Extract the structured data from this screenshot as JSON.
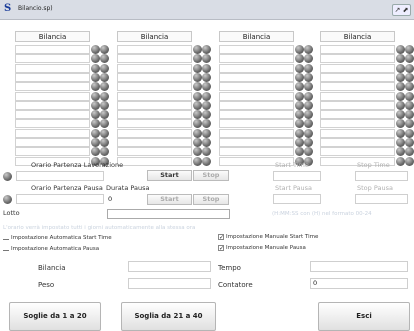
{
  "window": {
    "title": "Bilancio.sp)",
    "app_icon": "S",
    "controls": "↗ ⬈"
  },
  "columns": [
    {
      "header": "Bilancia"
    },
    {
      "header": "Bilancia"
    },
    {
      "header": "Bilancia"
    },
    {
      "header": "Bilancia"
    }
  ],
  "lavorazione": {
    "label": "Orario Partenza Lavorazione",
    "start": "Start",
    "stop": "Stop",
    "start_time_label": "Start Time",
    "stop_time_label": "Stop Time"
  },
  "pausa": {
    "label": "Orario Partenza Pausa",
    "durata_label": "Durata Pausa",
    "durata_value": "0",
    "start": "Start",
    "stop": "Stop",
    "start_pausa_label": "Start Pausa",
    "stop_pausa_label": "Stop Pausa",
    "format_hint": "(H:MM:SS con (H) nel formato 00-24"
  },
  "lotto": {
    "label": "Lotto",
    "value": ""
  },
  "info_text": "L'orario verrà impostato tutti i giorni automaticamente alla stessa ora",
  "options": {
    "auto_start": "Impostazione Automatica Start Time",
    "auto_pausa": "Impostazione Automatica Pausa",
    "manual_start": "Impostazione Manuale Start Time",
    "manual_pausa": "Impostazione Manuale Pausa",
    "checkmark": "✓"
  },
  "readouts": {
    "bilancia": "Bilancia",
    "peso": "Peso",
    "tempo": "Tempo",
    "contatore": "Contatore",
    "contatore_value": "0"
  },
  "buttons": {
    "soglie_1_20": "Soglie da 1 a 20",
    "soglia_21_40": "Soglia da 21 a 40",
    "esci": "Esci"
  }
}
